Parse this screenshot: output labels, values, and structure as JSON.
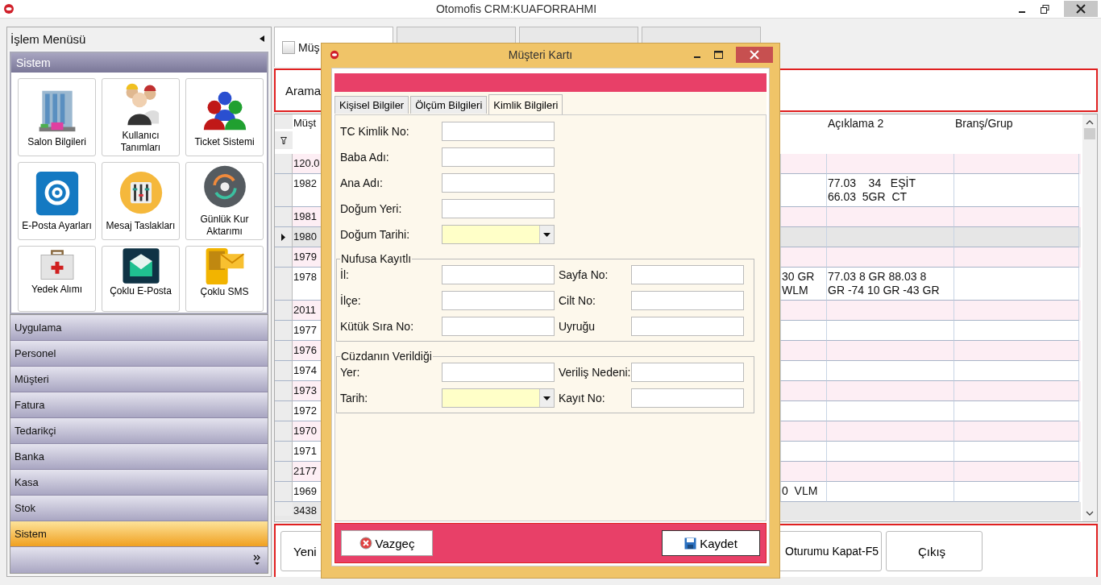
{
  "window": {
    "title": "Otomofis CRM:KUAFORRAHMI"
  },
  "sidebar": {
    "title": "İşlem Menüsü",
    "group": {
      "title": "Sistem",
      "tiles": [
        {
          "label": "Salon Bilgileri"
        },
        {
          "label": "Kullanıcı Tanımları"
        },
        {
          "label": "Ticket Sistemi"
        },
        {
          "label": "E-Posta Ayarları"
        },
        {
          "label": "Mesaj Taslakları"
        },
        {
          "label": "Günlük Kur Aktarımı"
        },
        {
          "label": "Yedek Alımı"
        },
        {
          "label": "Çoklu E-Posta"
        },
        {
          "label": "Çoklu SMS"
        }
      ]
    },
    "items": [
      {
        "label": "Uygulama",
        "selected": false
      },
      {
        "label": "Personel",
        "selected": false
      },
      {
        "label": "Müşteri",
        "selected": false
      },
      {
        "label": "Fatura",
        "selected": false
      },
      {
        "label": "Tedarikçi",
        "selected": false
      },
      {
        "label": "Banka",
        "selected": false
      },
      {
        "label": "Kasa",
        "selected": false
      },
      {
        "label": "Stok",
        "selected": false
      },
      {
        "label": "Sistem",
        "selected": true
      }
    ]
  },
  "tabs": [
    {
      "label": "Müş",
      "selected": true,
      "checked": false
    },
    {
      "selected": false
    },
    {
      "selected": false
    },
    {
      "selected": false
    }
  ],
  "search": {
    "label": "Arama"
  },
  "table": {
    "headers": {
      "column_1": "Müşt",
      "aciklama_2": "Açıklama 2",
      "brans_grup": "Branş/Grup"
    },
    "rows": [
      {
        "column_1": "120.0",
        "selected": false
      },
      {
        "column_1": "1982",
        "aciklama_2": "77.03    34   EŞİT\n66.03  5GR  CT",
        "selected": false
      },
      {
        "column_1": "1981",
        "selected": false
      },
      {
        "column_1": "1980",
        "selected": true
      },
      {
        "column_1": "1979",
        "selected": false
      },
      {
        "column_1": "1978",
        "column_3": "30 GR\nWLM",
        "aciklama_2": "77.03 8 GR 88.03 8\nGR -74 10 GR -43 GR",
        "selected": false
      },
      {
        "column_1": "2011",
        "selected": false
      },
      {
        "column_1": "1977",
        "selected": false
      },
      {
        "column_1": "1976",
        "selected": false
      },
      {
        "column_1": "1974",
        "selected": false
      },
      {
        "column_1": "1973",
        "selected": false
      },
      {
        "column_1": "1972",
        "selected": false
      },
      {
        "column_1": "1970",
        "selected": false
      },
      {
        "column_1": "1971",
        "selected": false
      },
      {
        "column_1": "2177",
        "selected": false
      },
      {
        "column_1": "1969",
        "column_3": "0  VLM",
        "selected": false
      }
    ],
    "footer": "3438"
  },
  "buttons": [
    {
      "label": "Yeni"
    },
    {
      "label": "Oturumu Kapat-F5"
    },
    {
      "label": "Çıkış"
    }
  ],
  "dialog": {
    "title": "Müşteri Kartı",
    "tabs": [
      {
        "label": "Kişisel Bilgiler",
        "selected": false
      },
      {
        "label": "Ölçüm Bilgileri",
        "selected": false
      },
      {
        "label": "Kimlik Bilgileri",
        "selected": true
      }
    ],
    "fields": [
      {
        "label": "TC Kimlik No:",
        "kind": "text"
      },
      {
        "label": "Baba Adı:",
        "kind": "text"
      },
      {
        "label": "Ana Adı:",
        "kind": "text"
      },
      {
        "label": "Doğum Yeri:",
        "kind": "text"
      },
      {
        "label": "Doğum Tarihi:",
        "kind": "date"
      }
    ],
    "groups": [
      {
        "title": "Nufusa Kayıtlı",
        "fields": [
          {
            "label": "İl:",
            "kind": "text"
          },
          {
            "label": "Sayfa No:",
            "kind": "text"
          },
          {
            "label": "İlçe:",
            "kind": "text"
          },
          {
            "label": "Cilt No:",
            "kind": "text"
          },
          {
            "label": "Kütük Sıra No:",
            "kind": "text"
          },
          {
            "label": "Uyruğu",
            "kind": "text"
          }
        ]
      },
      {
        "title": "Cüzdanın Verildiği",
        "fields": [
          {
            "label": "Yer:",
            "kind": "text"
          },
          {
            "label": "Veriliş Nedeni:",
            "kind": "text"
          },
          {
            "label": "Tarih:",
            "kind": "date"
          },
          {
            "label": "Kayıt No:",
            "kind": "text"
          }
        ]
      }
    ],
    "buttons": [
      {
        "label": "Vazgeç",
        "kind": "cancel"
      },
      {
        "label": "Kaydet",
        "kind": "save"
      }
    ]
  }
}
